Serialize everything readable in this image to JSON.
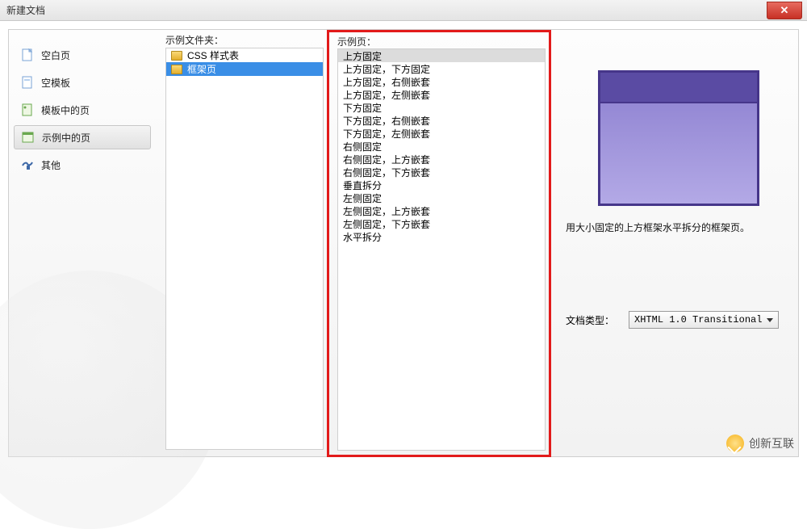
{
  "window": {
    "title": "新建文档"
  },
  "sidebar": {
    "items": [
      {
        "label": "空白页"
      },
      {
        "label": "空模板"
      },
      {
        "label": "模板中的页"
      },
      {
        "label": "示例中的页"
      },
      {
        "label": "其他"
      }
    ],
    "selected_index": 3
  },
  "columns": {
    "folders_label": "示例文件夹：",
    "pages_label": "示例页："
  },
  "folders": {
    "items": [
      {
        "label": "CSS 样式表"
      },
      {
        "label": "框架页"
      }
    ],
    "selected_index": 1
  },
  "pages": {
    "items": [
      "上方固定",
      "上方固定，下方固定",
      "上方固定，右侧嵌套",
      "上方固定，左侧嵌套",
      "下方固定",
      "下方固定，右侧嵌套",
      "下方固定，左侧嵌套",
      "右侧固定",
      "右侧固定，上方嵌套",
      "右侧固定，下方嵌套",
      "垂直拆分",
      "左侧固定",
      "左侧固定，上方嵌套",
      "左侧固定，下方嵌套",
      "水平拆分"
    ],
    "selected_index": 0
  },
  "preview": {
    "description": "用大小固定的上方框架水平拆分的框架页。"
  },
  "doctype": {
    "label": "文档类型：",
    "value": "XHTML 1.0 Transitional"
  },
  "watermark": {
    "text": "创新互联"
  }
}
